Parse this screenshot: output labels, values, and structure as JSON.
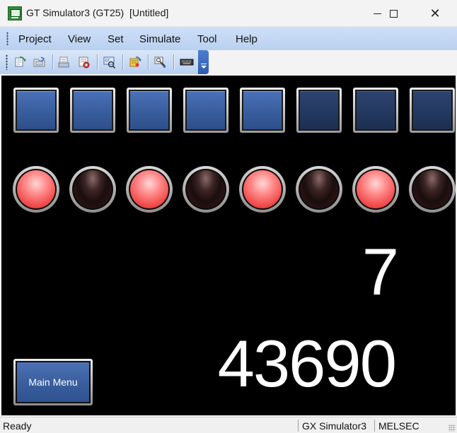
{
  "window": {
    "title": "GT Simulator3 (GT25)  [Untitled]",
    "icon": "gt-simulator-app-icon"
  },
  "menu": {
    "items": [
      {
        "label": "Project"
      },
      {
        "label": "View"
      },
      {
        "label": "Set"
      },
      {
        "label": "Simulate"
      },
      {
        "label": "Tool"
      },
      {
        "label": "Help"
      }
    ]
  },
  "toolbar": {
    "buttons": [
      {
        "icon": "start-simulation-icon"
      },
      {
        "icon": "open-project-icon"
      },
      {
        "icon": "print-icon"
      },
      {
        "icon": "device-monitor-icon"
      },
      {
        "icon": "screen-capture-icon"
      },
      {
        "icon": "refresh-device-icon"
      },
      {
        "icon": "touch-test-icon"
      },
      {
        "icon": "keyboard-icon"
      }
    ],
    "overflow_icon": "chevron-down-icon"
  },
  "screen": {
    "background": "#000000",
    "switches": [
      {
        "state": "on"
      },
      {
        "state": "on"
      },
      {
        "state": "on"
      },
      {
        "state": "on"
      },
      {
        "state": "on"
      },
      {
        "state": "off"
      },
      {
        "state": "off"
      },
      {
        "state": "off"
      }
    ],
    "lamps": [
      {
        "state": "on"
      },
      {
        "state": "off"
      },
      {
        "state": "on"
      },
      {
        "state": "off"
      },
      {
        "state": "on"
      },
      {
        "state": "off"
      },
      {
        "state": "on"
      },
      {
        "state": "off"
      }
    ],
    "numeric_display_1": "7",
    "numeric_display_2": "43690",
    "main_menu_label": "Main Menu",
    "colors": {
      "switch_on": "#3a5f9f",
      "switch_off": "#243a62",
      "lamp_on": "#f24b4b",
      "lamp_off": "#2a1414"
    }
  },
  "status": {
    "ready": "Ready",
    "plc": "GX Simulator3",
    "protocol": "MELSEC"
  }
}
